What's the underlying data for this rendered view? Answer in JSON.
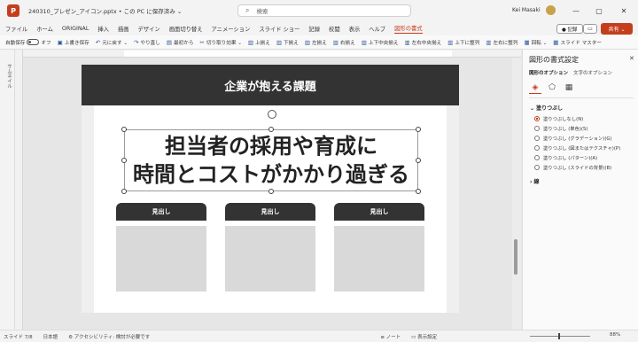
{
  "titlebar": {
    "app_icon": "P",
    "file_title": "240310_プレゼン_アイコン.pptx • この PC に保存済み ⌄",
    "search_placeholder": "検索",
    "user_name": "Kei Masaki",
    "minimize": "—",
    "maximize": "▢",
    "close": "✕"
  },
  "menu": {
    "items": [
      "ファイル",
      "ホーム",
      "ORIGINAL",
      "挿入",
      "描画",
      "デザイン",
      "画面切り替え",
      "アニメーション",
      "スライド ショー",
      "記録",
      "校閲",
      "表示",
      "ヘルプ",
      "図形の書式"
    ],
    "active": "図形の書式",
    "record": "● 記録",
    "comment": "▭",
    "share": "共有 ⌄"
  },
  "toolbar": {
    "autosave_label": "自動保存",
    "autosave_state": "オフ",
    "items": [
      {
        "icon": "▣",
        "label": "上書き保存"
      },
      {
        "icon": "↶",
        "label": "元に戻す ⌄"
      },
      {
        "icon": "↷",
        "label": "やり直し"
      },
      {
        "icon": "▤",
        "label": "最初から"
      },
      {
        "icon": "✂",
        "label": "切り取り効果 ⌄"
      },
      {
        "icon": "▥",
        "label": "上揃え"
      },
      {
        "icon": "▥",
        "label": "下揃え"
      },
      {
        "icon": "▥",
        "label": "左揃え"
      },
      {
        "icon": "▥",
        "label": "右揃え"
      },
      {
        "icon": "▥",
        "label": "上下中央揃え"
      },
      {
        "icon": "▥",
        "label": "左右中央揃え"
      },
      {
        "icon": "▥",
        "label": "上下に整列"
      },
      {
        "icon": "▥",
        "label": "左右に整列"
      },
      {
        "icon": "▦",
        "label": "回転 ⌄"
      },
      {
        "icon": "▦",
        "label": "スライド マスター"
      }
    ]
  },
  "thumbnails_label": "サムネイル",
  "slide": {
    "header_title": "企業が抱える課題",
    "headline_line1": "担当者の採用や育成に",
    "headline_line2": "時間とコストがかかり過ぎる",
    "cards": [
      {
        "heading": "見出し"
      },
      {
        "heading": "見出し"
      },
      {
        "heading": "見出し"
      }
    ]
  },
  "format_pane": {
    "title": "図形の書式設定",
    "close": "✕",
    "tabs": [
      "図形のオプション",
      "文字のオプション"
    ],
    "icons": [
      "paint-bucket-icon",
      "pentagon-icon",
      "size-icon"
    ],
    "icon_glyphs": [
      "◈",
      "⬠",
      "▦"
    ],
    "fill_section": "⌄ 塗りつぶし",
    "fill_options": [
      {
        "label": "塗りつぶしなし(N)",
        "selected": true
      },
      {
        "label": "塗りつぶし (単色)(S)",
        "selected": false
      },
      {
        "label": "塗りつぶし (グラデーション)(G)",
        "selected": false
      },
      {
        "label": "塗りつぶし (図またはテクスチャ)(P)",
        "selected": false
      },
      {
        "label": "塗りつぶし (パターン)(A)",
        "selected": false
      },
      {
        "label": "塗りつぶし (スライドの背景)(B)",
        "selected": false
      }
    ],
    "line_section": "› 線"
  },
  "statusbar": {
    "slide": "スライド 7/8",
    "language": "日本語",
    "accessibility": "⚙ アクセシビリティ: 検討が必要です",
    "notes": "≡ ノート",
    "display_settings": "▭ 表示設定",
    "zoom": "88%"
  },
  "colors": {
    "accent": "#c43e1c",
    "slide_dark": "#333333",
    "placeholder_gray": "#d9d9d9"
  }
}
